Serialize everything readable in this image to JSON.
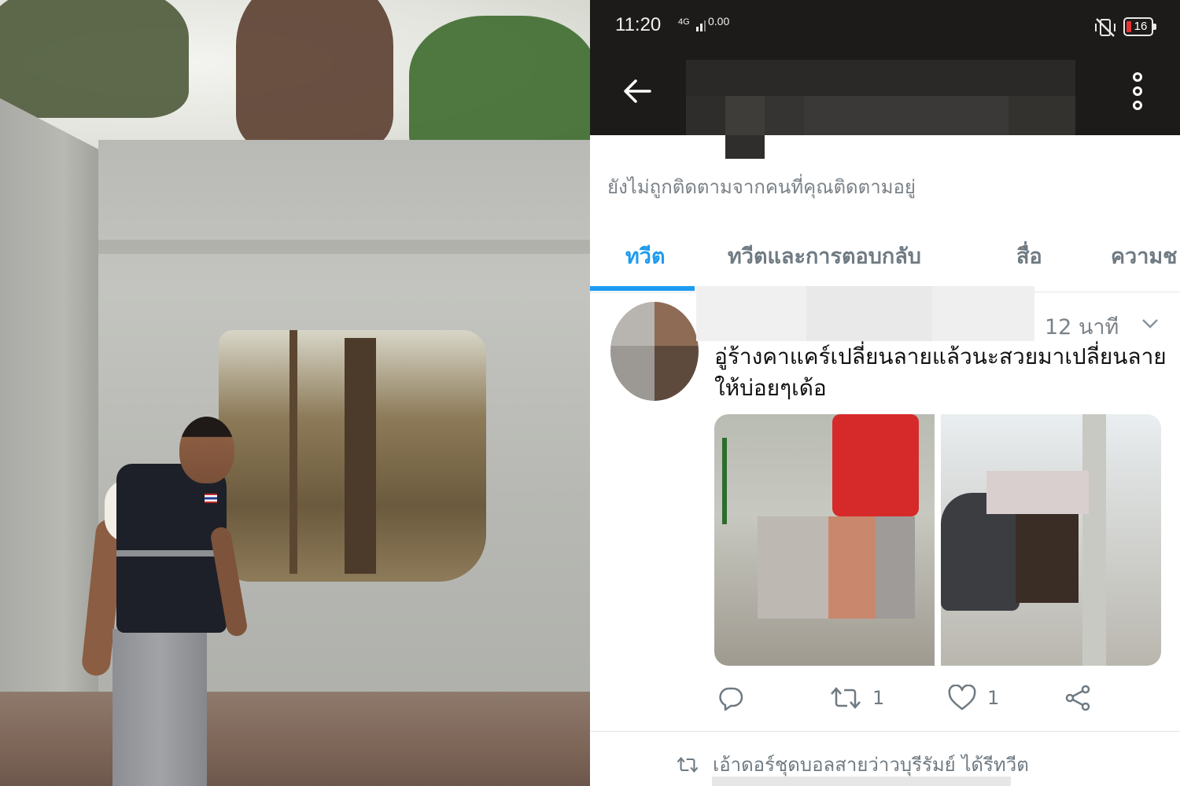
{
  "status_bar": {
    "time": "11:20",
    "network": "4G",
    "speed": "0.00",
    "battery": "16",
    "battery_color": "#e53333",
    "silent_icon": "vibrate-off-icon"
  },
  "app_bar": {
    "back_icon": "arrow-left-icon",
    "more_icon": "more-vertical-icon",
    "title_obscured": true
  },
  "profile": {
    "follow_notice": "ยังไม่ถูกติดตามจากคนที่คุณติดตามอยู่"
  },
  "tabs": [
    {
      "label": "ทวีต",
      "active": true
    },
    {
      "label": "ทวีตและการตอบกลับ",
      "active": false
    },
    {
      "label": "สื่อ",
      "active": false
    },
    {
      "label": "ความช",
      "active": false
    }
  ],
  "accent_color": "#1d9bf0",
  "tweet": {
    "time": "12 นาที",
    "text": "อู่ร้างคาแคร์เปลี่ยนลายแล้วนะสวยมาเปลี่ยนลายให้บ่อยๆเด้อ",
    "actions": {
      "reply_icon": "reply-icon",
      "retweet_icon": "retweet-icon",
      "retweet_count": "1",
      "like_icon": "heart-icon",
      "like_count": "1",
      "share_icon": "share-icon"
    }
  },
  "next_tweet": {
    "retweet_note": "เอ้าดอร์ชุดบอลสายว่าวบุรีรัมย์ ได้รีทวีต"
  }
}
